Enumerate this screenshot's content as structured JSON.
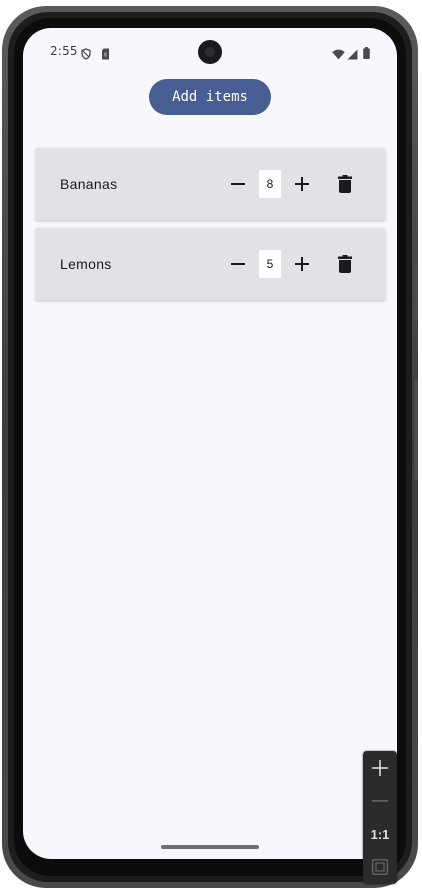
{
  "status_bar": {
    "time": "2:55",
    "left_icons": [
      "shield-icon",
      "sim-card-icon"
    ],
    "right_icons": [
      "wifi-icon",
      "cell-signal-icon",
      "battery-icon"
    ]
  },
  "toolbar": {
    "add_label": "Add items"
  },
  "items": [
    {
      "name": "Bananas",
      "quantity": "8"
    },
    {
      "name": "Lemons",
      "quantity": "5"
    }
  ],
  "zoom_controls": {
    "zoom_in_icon": "plus-icon",
    "zoom_out_icon": "minus-icon",
    "ratio_label": "1:1",
    "fit_icon": "fit-screen-icon"
  },
  "colors": {
    "accent": "#485e92",
    "background": "#f8f7fd",
    "row_background": "#e2e2e6",
    "icon": "#1b1b1f"
  }
}
